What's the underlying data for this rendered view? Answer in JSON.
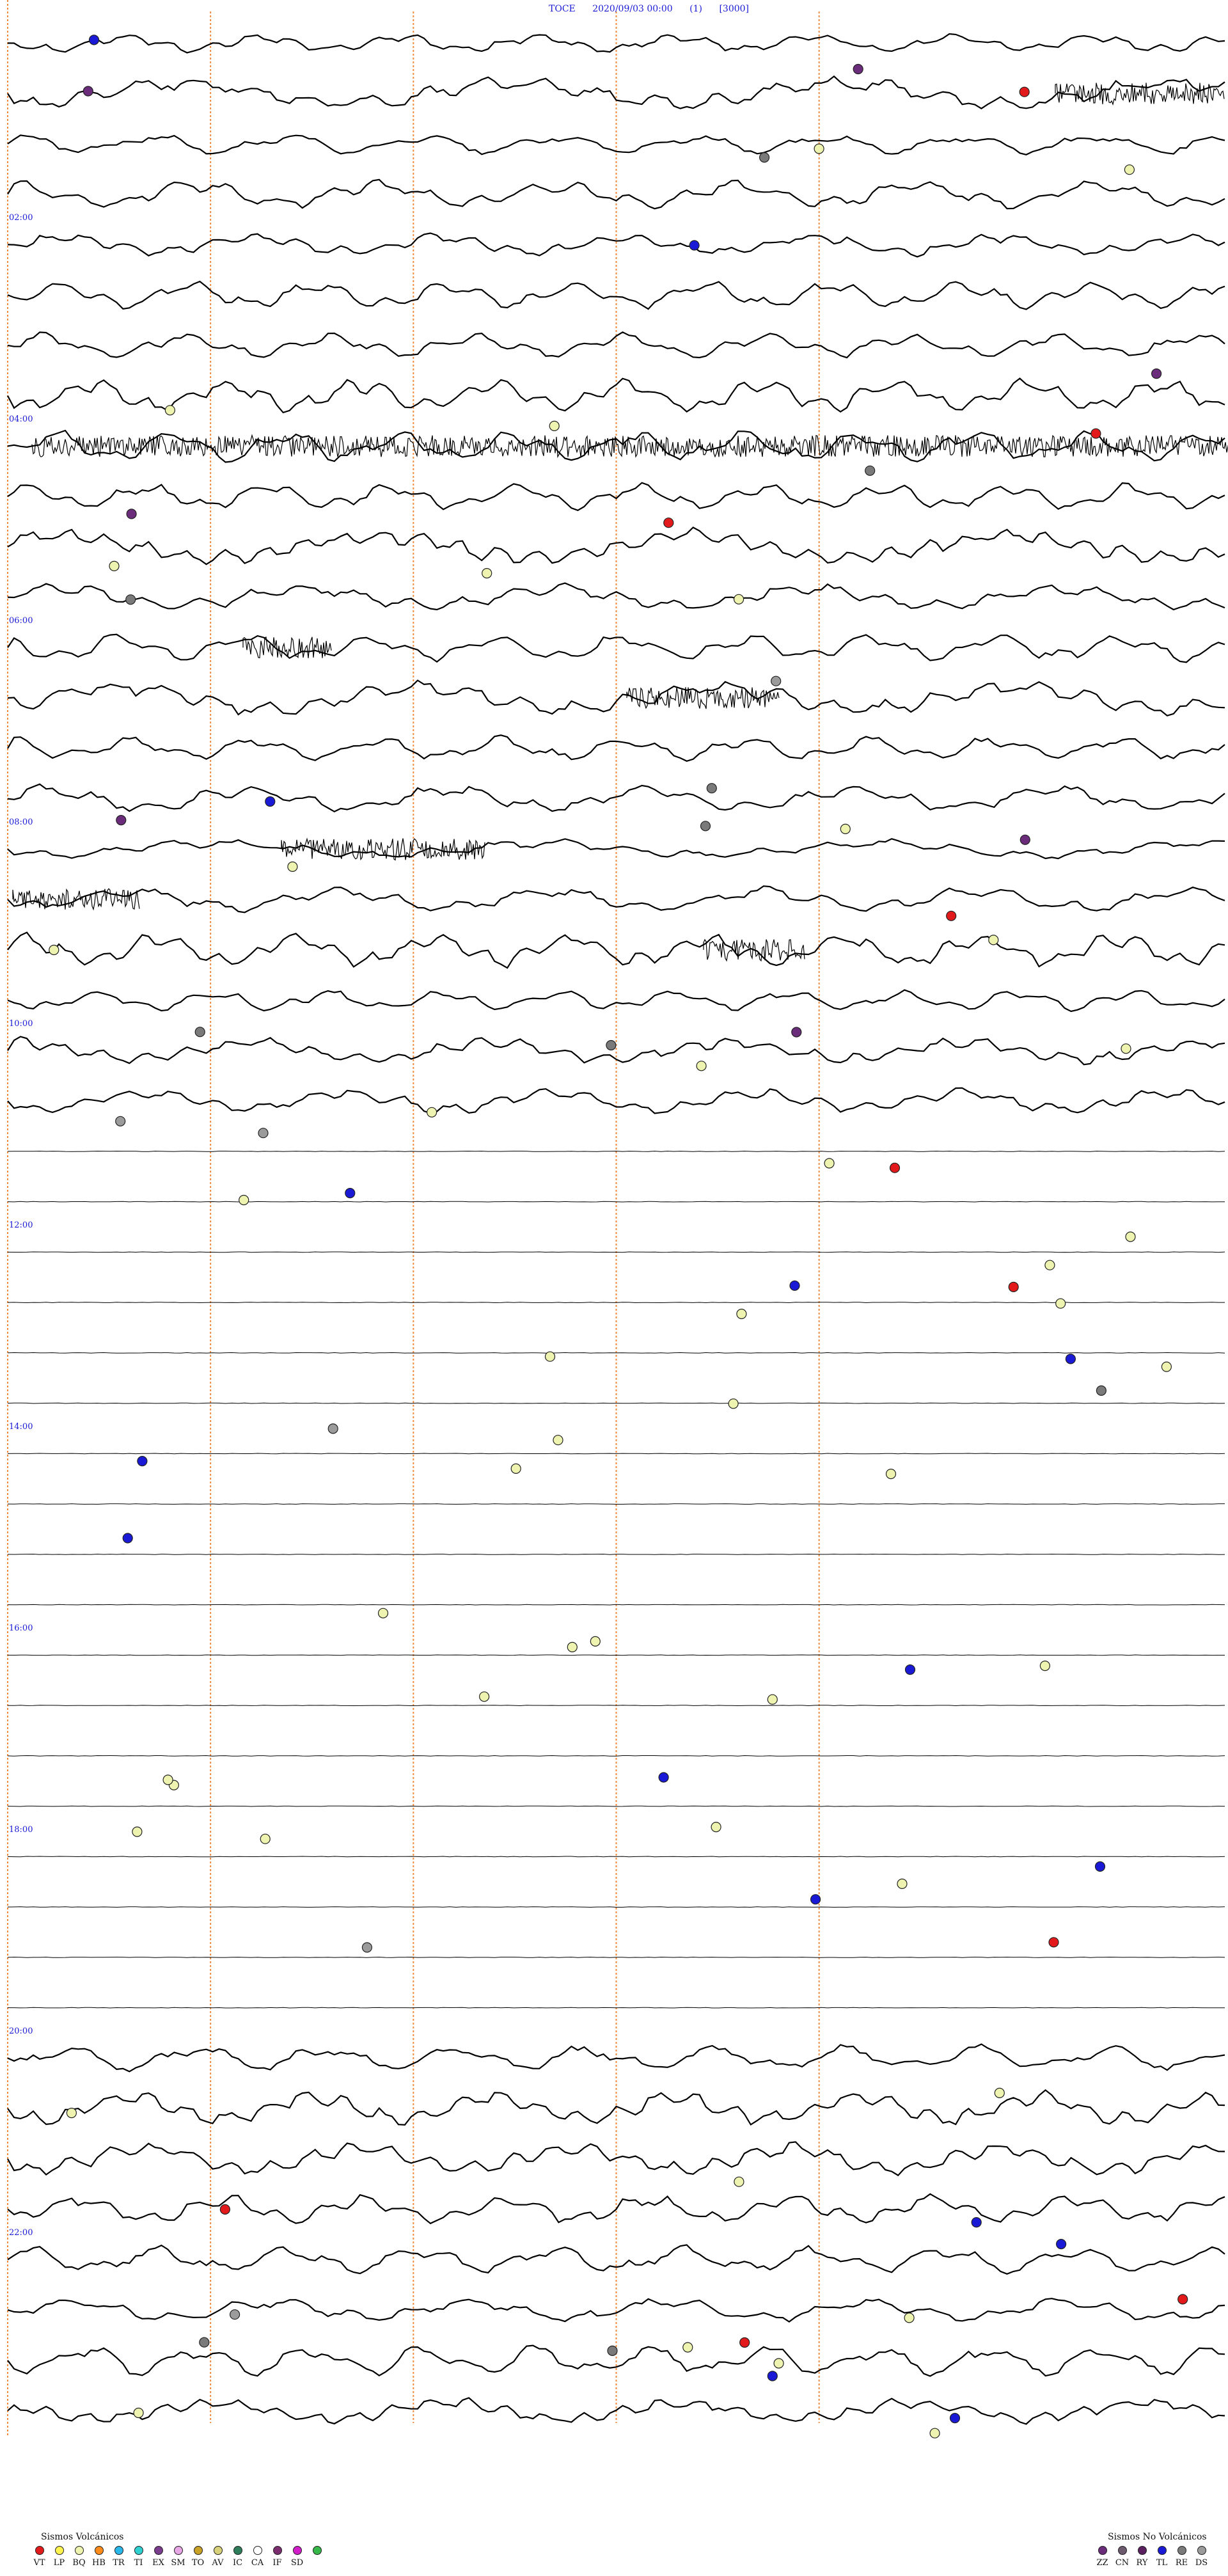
{
  "header": {
    "station": "TOCE",
    "datetime": "2020/09/03 00:00",
    "channel": "(1)",
    "scale": "[3000]"
  },
  "time_labels": [
    "02:00",
    "04:00",
    "06:00",
    "08:00",
    "10:00",
    "12:00",
    "14:00",
    "16:00",
    "18:00",
    "20:00",
    "22:00"
  ],
  "legend_volcanic": {
    "title": "Sismos Volcánicos",
    "items": [
      {
        "code": "VT",
        "color": "#e31a1c"
      },
      {
        "code": "LP",
        "color": "#fff44f"
      },
      {
        "code": "BQ",
        "color": "#eef4b0"
      },
      {
        "code": "HB",
        "color": "#ff8c1a"
      },
      {
        "code": "TR",
        "color": "#29b6e8"
      },
      {
        "code": "TI",
        "color": "#2fd0d0"
      },
      {
        "code": "EX",
        "color": "#7a3c8c"
      },
      {
        "code": "SM",
        "color": "#e7a6e6"
      },
      {
        "code": "TO",
        "color": "#c9a227"
      },
      {
        "code": "AV",
        "color": "#d9d27a"
      },
      {
        "code": "IC",
        "color": "#2e7d5b"
      },
      {
        "code": "CA",
        "color": "#ffffff"
      },
      {
        "code": "IF",
        "color": "#7b2d70"
      },
      {
        "code": "SD",
        "color": "#d21ec9"
      },
      {
        "code": "",
        "color": "#36b84a"
      }
    ]
  },
  "legend_nonvolcanic": {
    "title": "Sismos No Volcánicos",
    "items": [
      {
        "code": "ZZ",
        "color": "#6b2d7b"
      },
      {
        "code": "CN",
        "color": "#6e5a6e"
      },
      {
        "code": "RY",
        "color": "#5a2060"
      },
      {
        "code": "TL",
        "color": "#1a1ad6"
      },
      {
        "code": "RE",
        "color": "#7a7a7a"
      },
      {
        "code": "DS",
        "color": "#9b9b9b"
      }
    ]
  },
  "chart_data": {
    "type": "line",
    "title": "TOCE 2020/09/03 00:00 (1) [3000]",
    "x_range_minutes": [
      0,
      30
    ],
    "y_range_hours": [
      0,
      24
    ],
    "grid": true,
    "trace_interval_minutes": 30,
    "vertical_marker_minutes": [
      5,
      10,
      15,
      20
    ],
    "time_tick_labels": [
      "02:00",
      "04:00",
      "06:00",
      "08:00",
      "10:00",
      "12:00",
      "14:00",
      "16:00",
      "18:00",
      "20:00",
      "22:00"
    ],
    "trace_colors": {
      "trace": "#000000",
      "marker": "#f08a3c",
      "label": "#1a1ad6"
    }
  }
}
